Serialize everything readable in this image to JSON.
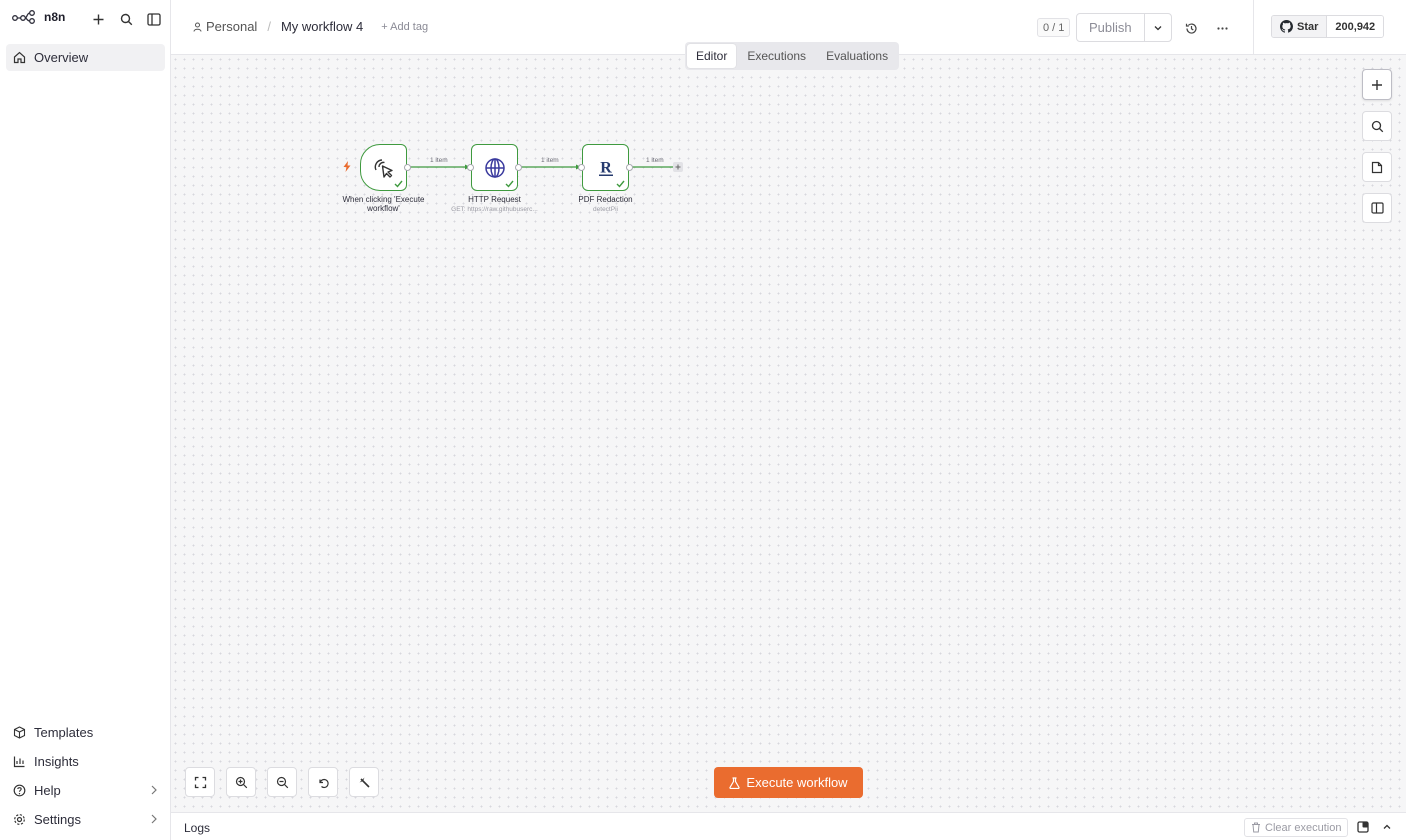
{
  "brand": {
    "name": "n8n"
  },
  "sidebar": {
    "top_items": [
      {
        "label": "Overview",
        "icon": "home-icon"
      }
    ],
    "bottom_items": [
      {
        "label": "Templates",
        "icon": "box-icon"
      },
      {
        "label": "Insights",
        "icon": "chart-icon"
      },
      {
        "label": "Help",
        "icon": "help-circle-icon"
      },
      {
        "label": "Settings",
        "icon": "gear-icon"
      }
    ]
  },
  "header": {
    "project": "Personal",
    "workflow_title": "My workflow 4",
    "add_tag": "+ Add tag",
    "counter": "0 / 1",
    "publish_label": "Publish",
    "github_star": "Star",
    "github_count": "200,942"
  },
  "tabs": [
    {
      "label": "Editor",
      "active": true
    },
    {
      "label": "Executions",
      "active": false
    },
    {
      "label": "Evaluations",
      "active": false
    }
  ],
  "nodes": [
    {
      "label": "When clicking 'Execute workflow'",
      "subtitle": ""
    },
    {
      "label": "HTTP Request",
      "subtitle": "GET: https://raw.githubuserc..."
    },
    {
      "label": "PDF Redaction",
      "subtitle": "detectPii"
    }
  ],
  "edges": [
    "1 item",
    "1 item",
    "1 item"
  ],
  "execute_button": "Execute workflow",
  "logs": {
    "title": "Logs",
    "clear": "Clear execution"
  },
  "colors": {
    "accent": "#ea6c2f",
    "success": "#3f9a3f"
  }
}
